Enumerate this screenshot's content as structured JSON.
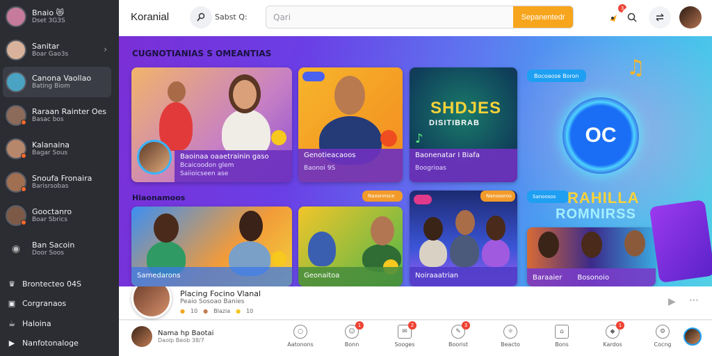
{
  "sidebar": {
    "items": [
      {
        "name": "Bnaio 😻",
        "sub": "Dset 3G3S",
        "color": "#c77b9a"
      },
      {
        "name": "Sanitar",
        "sub": "Boar Gao3s",
        "color": "#d8b29a"
      },
      {
        "name": "Canona Vaollao",
        "sub": "Bating Biom",
        "color": "#4aa3c2"
      },
      {
        "name": "Raraan Rainter Oes",
        "sub": "Basac bos",
        "color": "#8d6b5a"
      },
      {
        "name": "Kalanaina",
        "sub": "Bagar Sous",
        "color": "#b7876c"
      },
      {
        "name": "Snoufa Fronaira",
        "sub": "Barisrsobas",
        "color": "#a06f52"
      },
      {
        "name": "Gooctanro",
        "sub": "Boar Sbrics",
        "color": "#7d5a48"
      },
      {
        "name": "Ban Sacoin",
        "sub": "Door Soos",
        "color": "#555"
      }
    ],
    "links": [
      {
        "label": "Brontecteo 04S",
        "icon": "crown-icon"
      },
      {
        "label": "Corgranaos",
        "icon": "id-card-icon"
      },
      {
        "label": "Haloina",
        "icon": "cup-icon"
      },
      {
        "label": "Nanfotonaloge",
        "icon": "play-circle-icon"
      }
    ]
  },
  "header": {
    "logo": "Koranial",
    "label": "Sabst Q:",
    "search_placeholder": "Qari",
    "search_button": "Sepanentedr",
    "notification_badge": "3"
  },
  "hero": {
    "title": "CUGNOTIANIAS S OMEANTIAS",
    "section_label": "Hiaonamoos",
    "cards_top": [
      {
        "title": "Baoinaa oaaetrainin gaso",
        "sub": "Bcaicoodon glem",
        "sub2": "Saiioicseen ase"
      },
      {
        "title": "Genotieacaoos",
        "sub": "Baonoi 9S"
      },
      {
        "title": "Baonenatar I Biafa",
        "sub": "Boogrioas"
      }
    ],
    "promo_top_word1": "SHDJES",
    "promo_top_word2": "DISITIBRAB",
    "cards_bottom": [
      {
        "title": "Samedarons"
      },
      {
        "title": "Geonaitoa"
      },
      {
        "title": "Noiraaatrian"
      }
    ],
    "chip_bottom1": "Naxonnsce",
    "chip_bottom2": "Nanasoros",
    "promo_bottom_word1": "RAHILLA",
    "promo_bottom_word2": "ROMNIRSS",
    "promo_bottom_chip": "Sanoosos",
    "promo_bottom_foot1": "Baraaier",
    "promo_bottom_foot2": "Bosonoio",
    "right_chip": "Bocoaose Boron",
    "center_logo": "OC"
  },
  "nowplaying": {
    "title": "Placing Focino Vlanal",
    "sub": "Peaio Sosoao Banies",
    "meta1": "10",
    "meta2": "Blazia",
    "meta3": "10"
  },
  "bottombar": {
    "user_name": "Nama hp Baotai",
    "user_sub": "Daolp Beob 38/7",
    "nav": [
      {
        "label": "Aatonons",
        "badge": ""
      },
      {
        "label": "Bonn",
        "badge": "1"
      },
      {
        "label": "Sooges",
        "badge": "2"
      },
      {
        "label": "Boorist",
        "badge": "3"
      },
      {
        "label": "Beacto",
        "badge": ""
      },
      {
        "label": "Bons",
        "badge": ""
      },
      {
        "label": "Kardos",
        "badge": "1"
      },
      {
        "label": "Cocng",
        "badge": ""
      }
    ]
  }
}
